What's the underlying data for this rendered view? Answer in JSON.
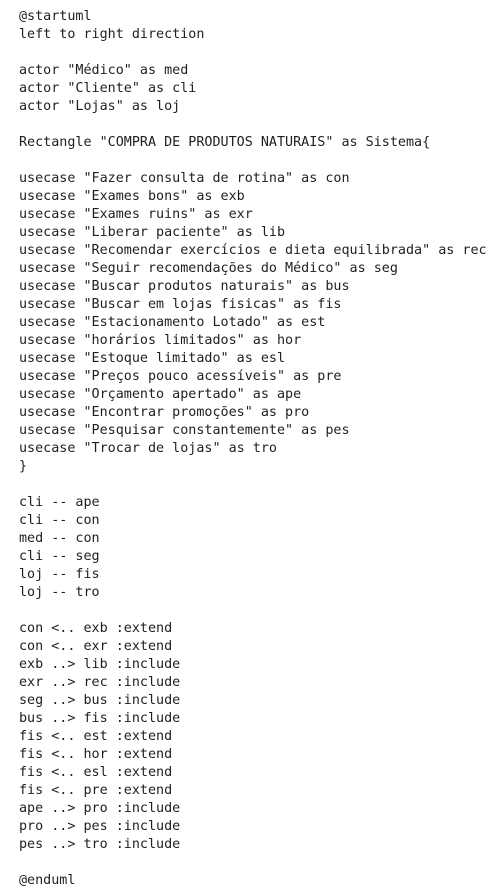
{
  "code_lines": [
    "@startuml",
    "left to right direction",
    "",
    "actor \"Médico\" as med",
    "actor \"Cliente\" as cli",
    "actor \"Lojas\" as loj",
    "",
    "Rectangle \"COMPRA DE PRODUTOS NATURAIS\" as Sistema{",
    "",
    "usecase \"Fazer consulta de rotina\" as con",
    "usecase \"Exames bons\" as exb",
    "usecase \"Exames ruins\" as exr",
    "usecase \"Liberar paciente\" as lib",
    "usecase \"Recomendar exercícios e dieta equilibrada\" as rec",
    "usecase \"Seguir recomendações do Médico\" as seg",
    "usecase \"Buscar produtos naturais\" as bus",
    "usecase \"Buscar em lojas fisicas\" as fis",
    "usecase \"Estacionamento Lotado\" as est",
    "usecase \"horários limitados\" as hor",
    "usecase \"Estoque limitado\" as esl",
    "usecase \"Preços pouco acessíveis\" as pre",
    "usecase \"Orçamento apertado\" as ape",
    "usecase \"Encontrar promoções\" as pro",
    "usecase \"Pesquisar constantemente\" as pes",
    "usecase \"Trocar de lojas\" as tro",
    "}",
    "",
    "cli -- ape",
    "cli -- con",
    "med -- con",
    "cli -- seg",
    "loj -- fis",
    "loj -- tro",
    "",
    "con <.. exb :extend",
    "con <.. exr :extend",
    "exb ..> lib :include",
    "exr ..> rec :include",
    "seg ..> bus :include",
    "bus ..> fis :include",
    "fis <.. est :extend",
    "fis <.. hor :extend",
    "fis <.. esl :extend",
    "fis <.. pre :extend",
    "ape ..> pro :include",
    "pro ..> pes :include",
    "pes ..> tro :include",
    "",
    "@enduml"
  ]
}
